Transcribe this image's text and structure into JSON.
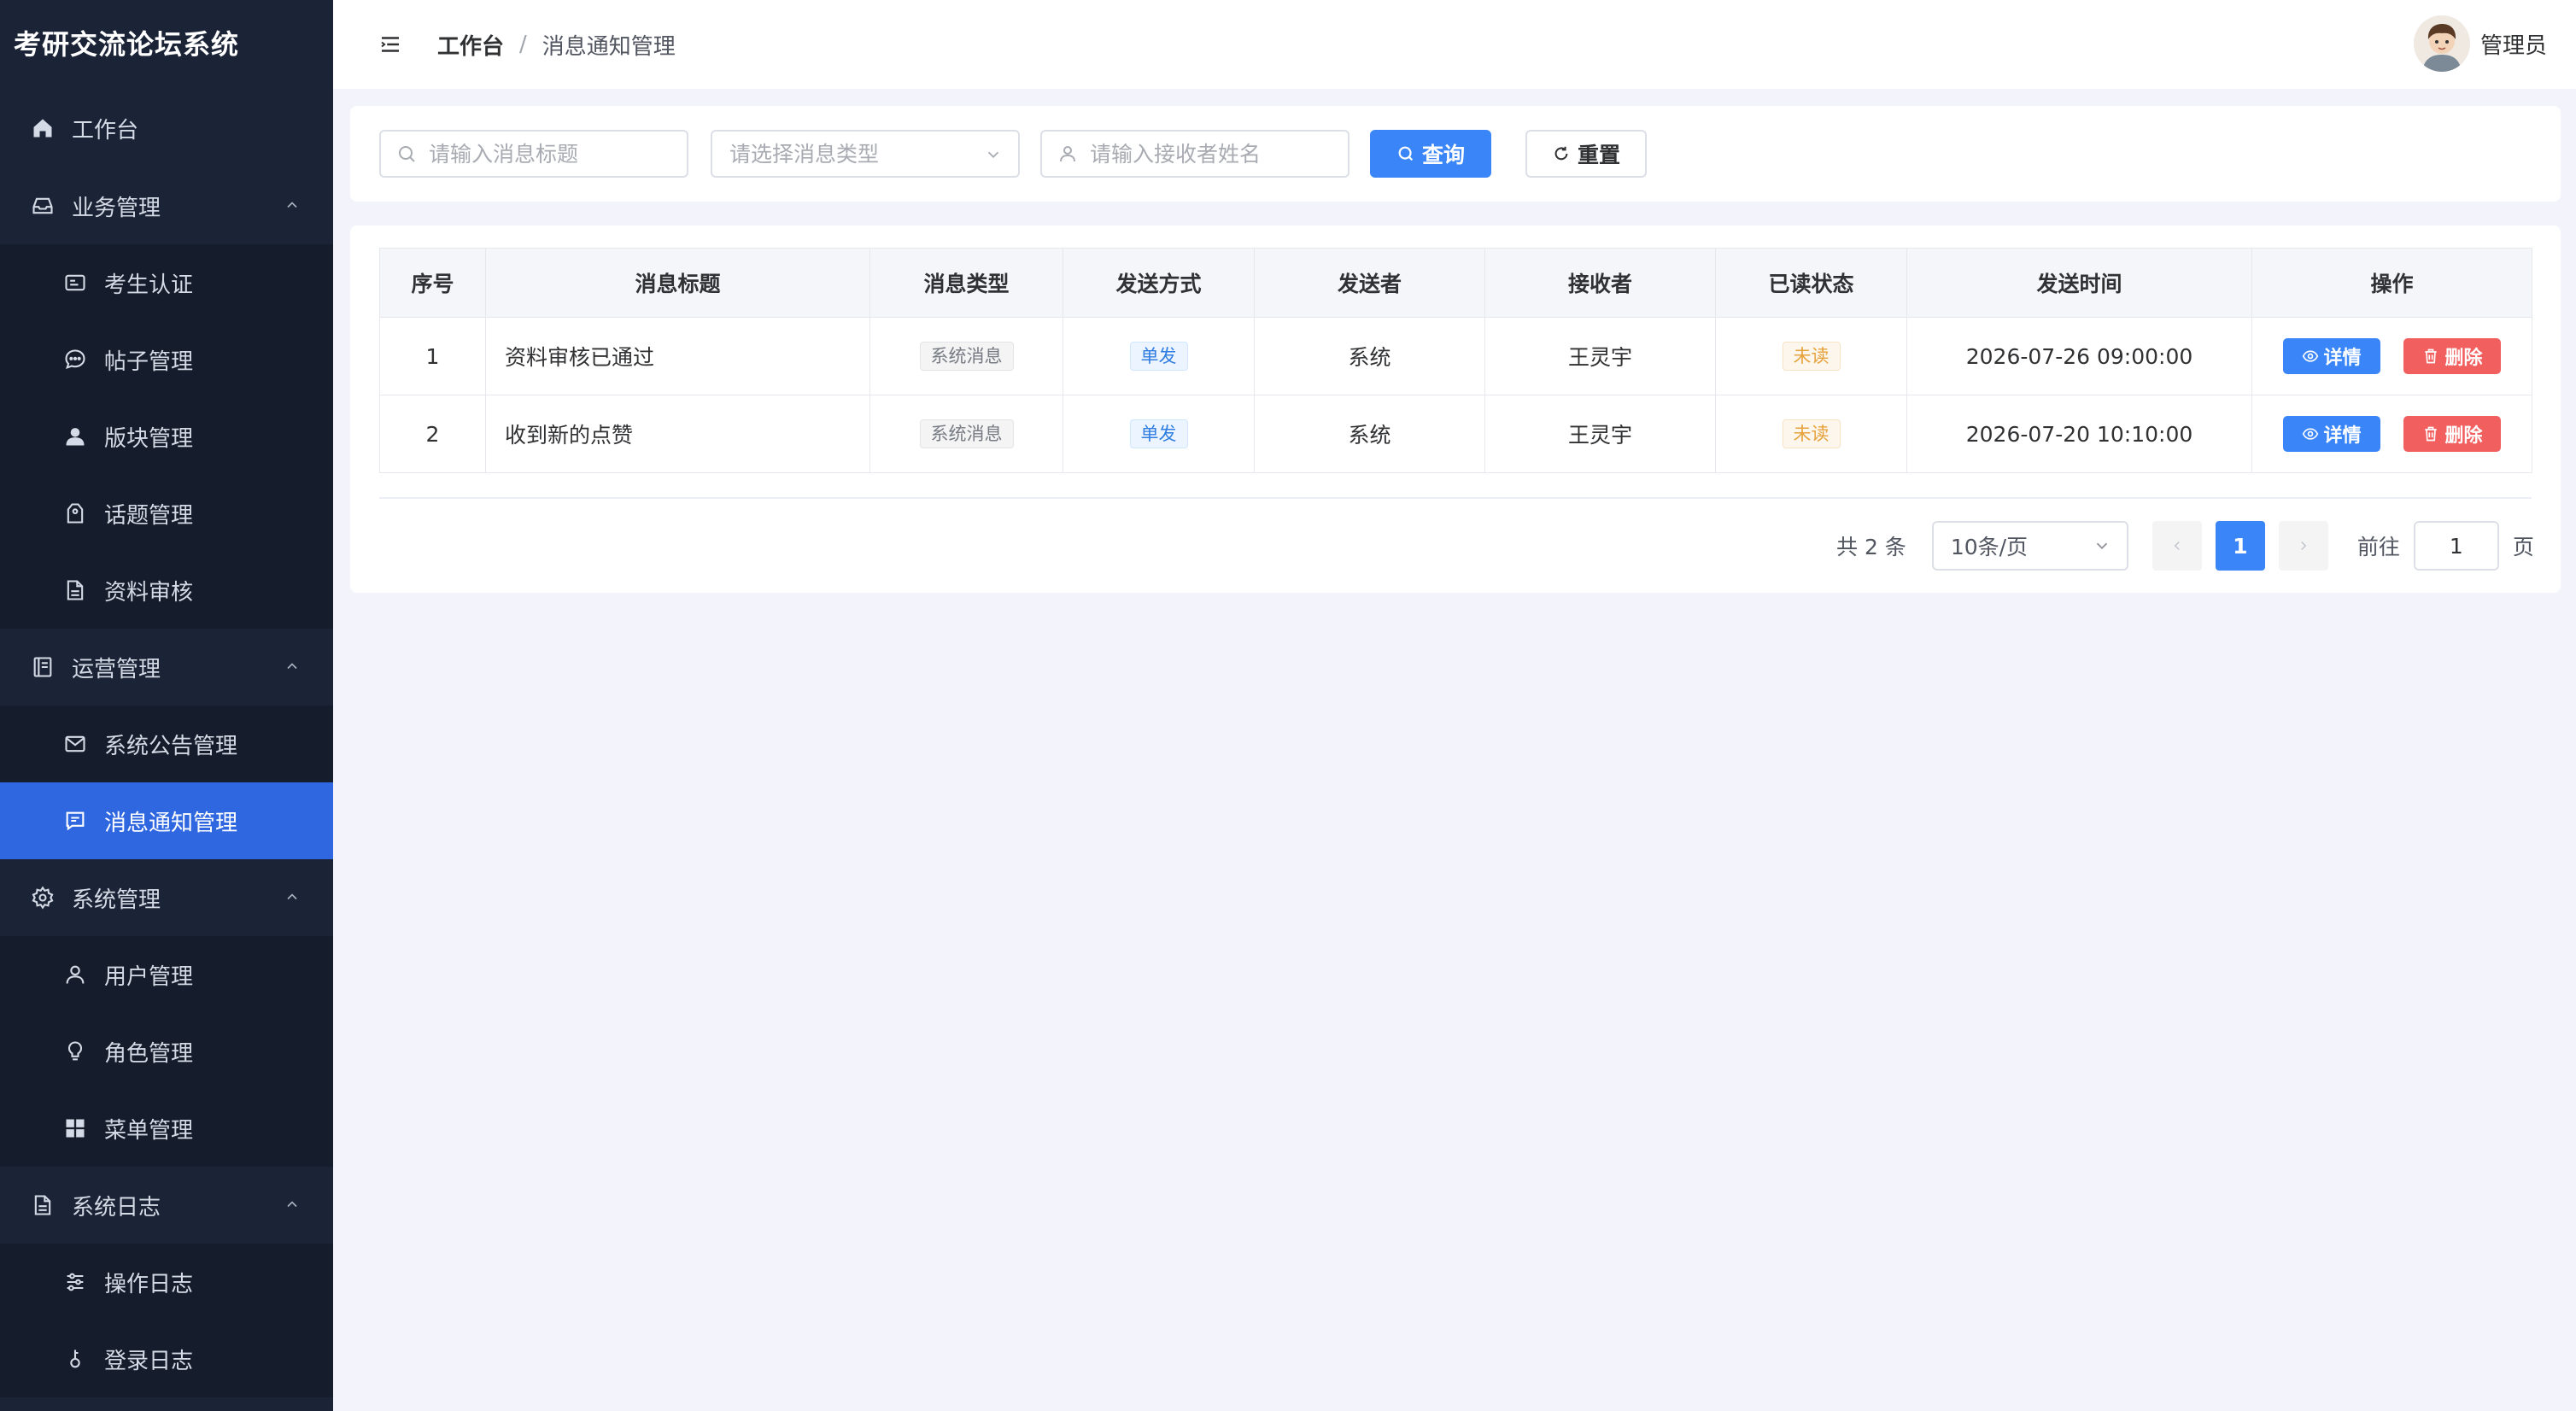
{
  "app": {
    "title": "考研交流论坛系统"
  },
  "sidebar": {
    "workbench": "工作台",
    "groups": [
      {
        "label": "业务管理",
        "items": [
          "考生认证",
          "帖子管理",
          "版块管理",
          "话题管理",
          "资料审核"
        ]
      },
      {
        "label": "运营管理",
        "items": [
          "系统公告管理",
          "消息通知管理"
        ]
      },
      {
        "label": "系统管理",
        "items": [
          "用户管理",
          "角色管理",
          "菜单管理"
        ]
      },
      {
        "label": "系统日志",
        "items": [
          "操作日志",
          "登录日志"
        ]
      }
    ],
    "active_item": "消息通知管理"
  },
  "header": {
    "breadcrumb_root": "工作台",
    "breadcrumb_sep": "/",
    "breadcrumb_current": "消息通知管理",
    "user_name": "管理员"
  },
  "search": {
    "title_placeholder": "请输入消息标题",
    "type_placeholder": "请选择消息类型",
    "receiver_placeholder": "请输入接收者姓名",
    "query_label": "查询",
    "reset_label": "重置"
  },
  "table": {
    "headers": [
      "序号",
      "消息标题",
      "消息类型",
      "发送方式",
      "发送者",
      "接收者",
      "已读状态",
      "发送时间",
      "操作"
    ],
    "rows": [
      {
        "index": "1",
        "title": "资料审核已通过",
        "type": "系统消息",
        "method": "单发",
        "sender": "系统",
        "receiver": "王灵宇",
        "status": "未读",
        "time": "2026-07-26 09:00:00"
      },
      {
        "index": "2",
        "title": "收到新的点赞",
        "type": "系统消息",
        "method": "单发",
        "sender": "系统",
        "receiver": "王灵宇",
        "status": "未读",
        "time": "2026-07-20 10:10:00"
      }
    ],
    "detail_label": "详情",
    "delete_label": "删除"
  },
  "pagination": {
    "total_text": "共 2 条",
    "page_size": "10条/页",
    "current_page": "1",
    "goto_label": "前往",
    "goto_value": "1",
    "page_suffix": "页"
  },
  "colors": {
    "sidebar_bg": "#1b2436",
    "active": "#2f67e0",
    "primary": "#3a86f8",
    "danger": "#f25f5f"
  }
}
